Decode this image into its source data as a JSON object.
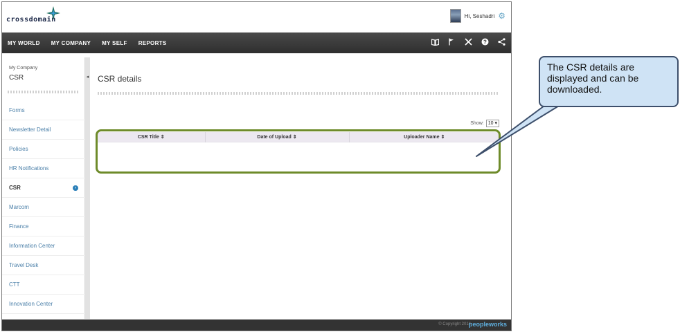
{
  "header": {
    "logo_text": "crossdomain",
    "greeting": "Hi, Seshadri"
  },
  "nav": {
    "items": [
      "MY WORLD",
      "MY COMPANY",
      "MY SELF",
      "REPORTS"
    ],
    "icons": [
      "book-icon",
      "flag-icon",
      "tools-icon",
      "help-icon",
      "share-icon"
    ]
  },
  "sidebar": {
    "subtitle": "My Company",
    "title": "CSR",
    "items": [
      {
        "label": "Forms"
      },
      {
        "label": "Newsletter Detail"
      },
      {
        "label": "Policies"
      },
      {
        "label": "HR Notifications"
      },
      {
        "label": "CSR",
        "active": true
      },
      {
        "label": "Marcom"
      },
      {
        "label": "Finance"
      },
      {
        "label": "Information Center"
      },
      {
        "label": "Travel Desk"
      },
      {
        "label": "CTT"
      },
      {
        "label": "Innovation Center"
      }
    ]
  },
  "main": {
    "title": "CSR details",
    "show_label": "Show:",
    "show_value": "10",
    "columns": [
      "CSR Title",
      "Date of Upload",
      "Uploader Name"
    ]
  },
  "footer": {
    "copyright": "© Copyright 2014",
    "brand": "peopleworks"
  },
  "callout": {
    "text": "The CSR details are displayed and can be downloaded."
  },
  "colors": {
    "nav_bg": "#333333",
    "link": "#4a7fa8",
    "highlight": "#6e8b2a",
    "callout_bg": "#cfe3f5"
  }
}
